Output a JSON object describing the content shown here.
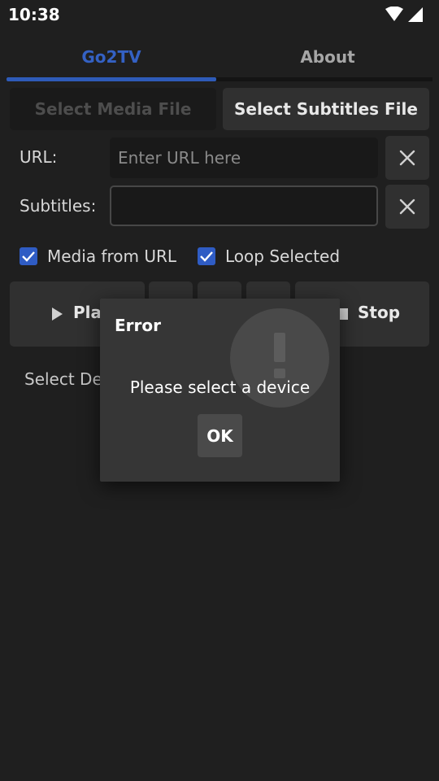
{
  "status_bar": {
    "time": "10:38",
    "icons": [
      "wifi-icon",
      "cellular-signal-icon"
    ]
  },
  "tabs": [
    {
      "label": "Go2TV",
      "active": true
    },
    {
      "label": "About",
      "active": false
    }
  ],
  "files": {
    "select_media_label": "Select Media File",
    "select_media_enabled": false,
    "select_subtitles_label": "Select Subtitles File"
  },
  "url": {
    "label": "URL:",
    "placeholder": "Enter URL here",
    "value": ""
  },
  "subtitles": {
    "label": "Subtitles:",
    "value": ""
  },
  "options": {
    "media_from_url": {
      "label": "Media from URL",
      "checked": true
    },
    "loop_selected": {
      "label": "Loop Selected",
      "checked": true
    }
  },
  "controls": {
    "play_label": "Pla",
    "stop_label": "Stop"
  },
  "device_text": "Select Dev",
  "dialog": {
    "title": "Error",
    "message": "Please select a device",
    "ok_label": "OK",
    "icon": "exclamation-icon"
  },
  "colors": {
    "accent": "#2e5bb8",
    "background": "#1f1f1f",
    "dialog": "#363636"
  }
}
